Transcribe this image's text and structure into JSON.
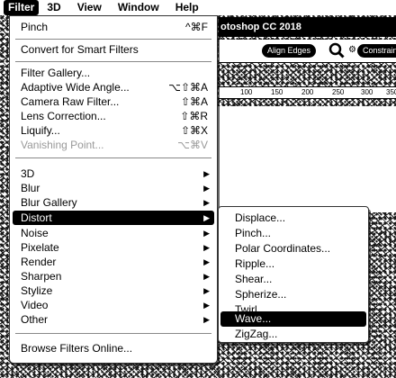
{
  "menubar": {
    "items": [
      {
        "label": "Filter",
        "active": true
      },
      {
        "label": "3D"
      },
      {
        "label": "View"
      },
      {
        "label": "Window"
      },
      {
        "label": "Help"
      }
    ]
  },
  "document": {
    "tab_title": "otoshop CC 2018",
    "options": {
      "align_edges_label": "Align Edges",
      "constrain_label": "Constrain"
    },
    "ruler_ticks": [
      "100",
      "150",
      "200",
      "250",
      "300",
      "350"
    ]
  },
  "filter_menu": {
    "last_filter": {
      "label": "Pinch",
      "shortcut": "^⌘F"
    },
    "convert_smart": "Convert for Smart Filters",
    "group1": [
      {
        "label": "Filter Gallery...",
        "shortcut": ""
      },
      {
        "label": "Adaptive Wide Angle...",
        "shortcut": "⌥⇧⌘A"
      },
      {
        "label": "Camera Raw Filter...",
        "shortcut": "⇧⌘A"
      },
      {
        "label": "Lens Correction...",
        "shortcut": "⇧⌘R"
      },
      {
        "label": "Liquify...",
        "shortcut": "⇧⌘X"
      },
      {
        "label": "Vanishing Point...",
        "shortcut": "⌥⌘V",
        "disabled": true
      }
    ],
    "submenus": [
      {
        "label": "3D"
      },
      {
        "label": "Blur"
      },
      {
        "label": "Blur Gallery"
      },
      {
        "label": "Distort",
        "highlighted": true
      },
      {
        "label": "Noise"
      },
      {
        "label": "Pixelate"
      },
      {
        "label": "Render"
      },
      {
        "label": "Sharpen"
      },
      {
        "label": "Stylize"
      },
      {
        "label": "Video"
      },
      {
        "label": "Other"
      }
    ],
    "browse_online": "Browse Filters Online..."
  },
  "distort_menu": {
    "items": [
      {
        "label": "Displace..."
      },
      {
        "label": "Pinch..."
      },
      {
        "label": "Polar Coordinates..."
      },
      {
        "label": "Ripple..."
      },
      {
        "label": "Shear..."
      },
      {
        "label": "Spherize..."
      },
      {
        "label": "Twirl..."
      },
      {
        "label": "Wave...",
        "highlighted": true
      },
      {
        "label": "ZigZag..."
      }
    ]
  },
  "colors": {
    "highlight": "#000000",
    "menu_bg": "#ffffff",
    "disabled": "#999999"
  }
}
